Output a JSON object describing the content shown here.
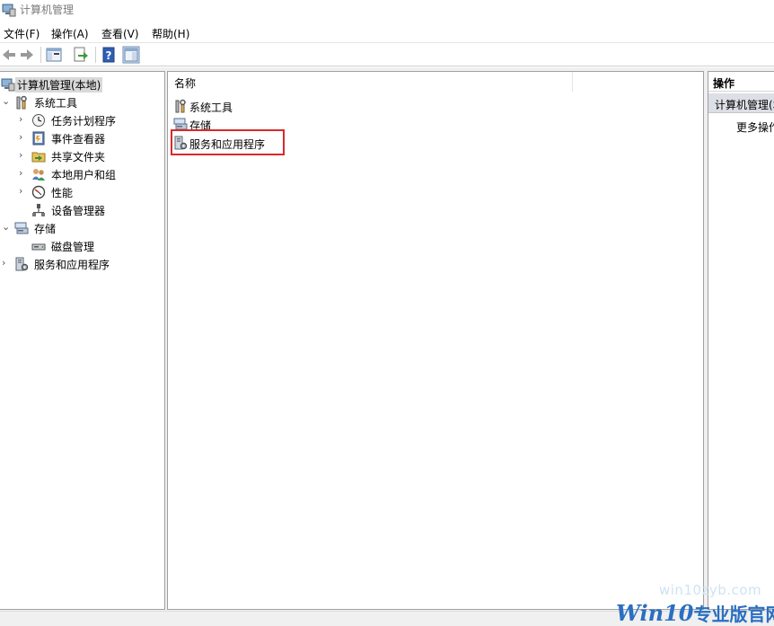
{
  "window": {
    "title": "计算机管理"
  },
  "menu": [
    {
      "label": "文件(F)"
    },
    {
      "label": "操作(A)"
    },
    {
      "label": "查看(V)"
    },
    {
      "label": "帮助(H)"
    }
  ],
  "toolbar": {
    "buttons": [
      "back-icon",
      "forward-icon",
      "show-hide-console-tree-icon",
      "export-list-icon",
      "help-icon",
      "show-hide-action-pane-icon"
    ]
  },
  "tree": {
    "root": "计算机管理(本地)",
    "system_tools": "系统工具",
    "task_scheduler": "任务计划程序",
    "event_viewer": "事件查看器",
    "shared_folders": "共享文件夹",
    "local_users": "本地用户和组",
    "performance": "性能",
    "device_manager": "设备管理器",
    "storage": "存储",
    "disk_management": "磁盘管理",
    "services_apps": "服务和应用程序"
  },
  "center": {
    "column_header": "名称",
    "items": [
      {
        "label": "系统工具"
      },
      {
        "label": "存储"
      },
      {
        "label": "服务和应用程序"
      }
    ],
    "highlight_color": "#d9292b"
  },
  "actions": {
    "header": "操作",
    "section": "计算机管理(本地)",
    "more": "更多操作"
  },
  "watermark": {
    "url": "win10zyb.com",
    "brand_latin": "Win10",
    "brand_cn": "专业版官网"
  }
}
